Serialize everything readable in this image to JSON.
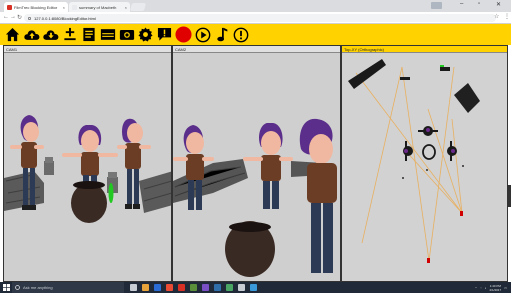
{
  "browser": {
    "tabs": [
      {
        "title": "FilmTrec Blocking Editor",
        "active": true
      },
      {
        "title": "summary of Macbeth",
        "active": false
      }
    ],
    "address": "127.0.0.1:8080/BlockingEditor.html",
    "window_controls": [
      "minimize",
      "restore",
      "close"
    ]
  },
  "toolbar": {
    "buttons": [
      {
        "name": "home-icon"
      },
      {
        "name": "cloud-upload-icon"
      },
      {
        "name": "cloud-download-icon"
      },
      {
        "name": "add-object-icon"
      },
      {
        "name": "script-icon"
      },
      {
        "name": "storyboard-icon"
      },
      {
        "name": "camera-icon"
      },
      {
        "name": "settings-icon"
      },
      {
        "name": "speech-bubble-icon"
      },
      {
        "name": "record-icon"
      },
      {
        "name": "play-icon"
      },
      {
        "name": "music-icon"
      },
      {
        "name": "info-icon"
      }
    ],
    "accent": "#ffd200",
    "record_color": "#e00000"
  },
  "viewports": [
    {
      "label": "CAM1"
    },
    {
      "label": "CAM2"
    },
    {
      "label": "Top-XY (Orthographic)"
    }
  ],
  "taskbar": {
    "search_placeholder": "Ask me anything",
    "time": "1:40 PM",
    "date": "2/1/2017"
  }
}
